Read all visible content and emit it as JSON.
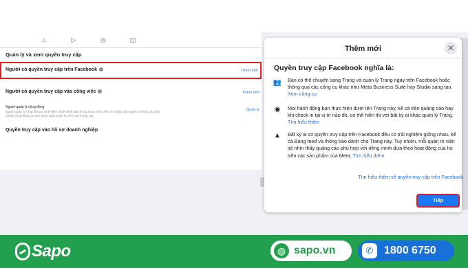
{
  "left_panel": {
    "nav_icons": [
      "home-icon",
      "video-icon",
      "globe-icon",
      "gaming-icon"
    ],
    "section_title": "Quản lý và xem quyền truy cập",
    "facebook_access": {
      "label": "Người có quyền truy cập trên Facebook",
      "link": "Thêm mới"
    },
    "task_access": {
      "label": "Người có quyền truy cập vào công việc",
      "link": "Thêm mới"
    },
    "community_manager": {
      "label": "Người quản lý cộng đồng",
      "description": "Người quản lý cộng đồng có thể kiểm duyệt bình luận trong đoạn chat, đình chỉ hoặc xóa người vi phạm các tiêu chuẩn cộng đồng và xem danh sách quản trị viên của Trang này.",
      "link": "Quản lý"
    },
    "business_profile": "Quyền truy cập vào hồ sơ doanh nghiệp"
  },
  "modal": {
    "title": "Thêm mới",
    "close_icon": "close-icon",
    "heading": "Quyền truy cập Facebook nghĩa là:",
    "items": [
      {
        "icon": "people-icon",
        "text": "Bạn có thể chuyển sang Trang và quản lý Trang ngay trên Facebook hoặc thông qua các công cụ khác như Meta Business Suite hay Studio sáng tạo.",
        "link": "Xem công cụ"
      },
      {
        "icon": "eye-icon",
        "text": "Mọi hành động bạn thực hiện dưới tên Trang này, kể cả trên quảng cáo hay khi check in tại vị trí nào đó, có thể hiển thị với bất kỳ ai khác quản lý Trang.",
        "link": "Tìm hiểu thêm"
      },
      {
        "icon": "warning-icon",
        "text": "Bất kỳ ai có quyền truy cập trên Facebook đều có trải nghiệm giống nhau, kể cả Bảng feed và thông báo dành cho Trang này. Tuy nhiên, mỗi quản trị viên sẽ nhìn thấy quảng cáo phù hợp với riêng mình dựa theo hoạt động của họ trên các sản phẩm của Meta.",
        "link": "Tìm hiểu thêm"
      }
    ],
    "more_link": "Tìm hiểu thêm về quyền truy cập trên Facebook.",
    "next_button": "Tiếp"
  },
  "footer": {
    "brand": "Sapo",
    "website": "sapo.vn",
    "phone": "1800 6750",
    "colors": {
      "brand_green": "#22a04d",
      "phone_blue": "#1871d8"
    }
  }
}
